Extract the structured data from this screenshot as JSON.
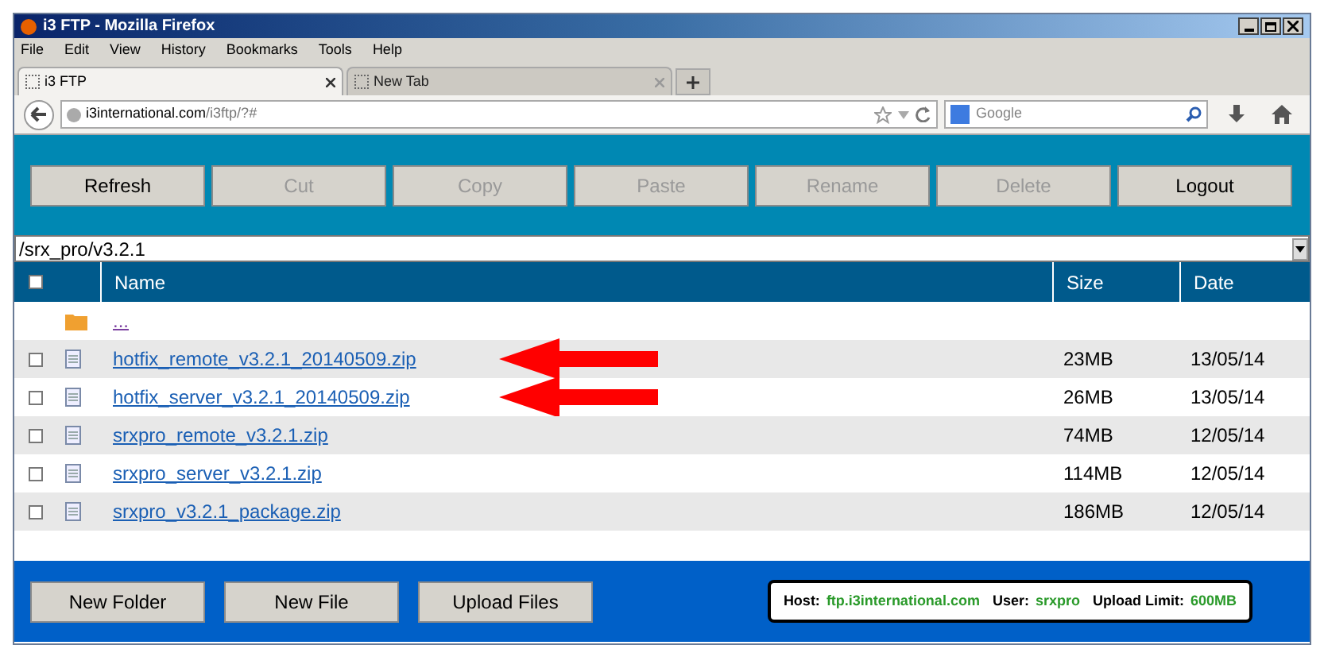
{
  "window": {
    "title": "i3 FTP - Mozilla Firefox"
  },
  "menu": [
    "File",
    "Edit",
    "View",
    "History",
    "Bookmarks",
    "Tools",
    "Help"
  ],
  "tabs": [
    {
      "label": "i3 FTP",
      "selected": true
    },
    {
      "label": "New Tab",
      "selected": false
    }
  ],
  "address": {
    "host": "i3international.com",
    "path": "/i3ftp/?#"
  },
  "search": {
    "placeholder": "Google"
  },
  "toolbar": [
    {
      "label": "Refresh",
      "disabled": false
    },
    {
      "label": "Cut",
      "disabled": true
    },
    {
      "label": "Copy",
      "disabled": true
    },
    {
      "label": "Paste",
      "disabled": true
    },
    {
      "label": "Rename",
      "disabled": true
    },
    {
      "label": "Delete",
      "disabled": true
    },
    {
      "label": "Logout",
      "disabled": false
    }
  ],
  "path": "/srx_pro/v3.2.1",
  "table": {
    "columns": [
      "Name",
      "Size",
      "Date"
    ],
    "select_all": false,
    "rows": [
      {
        "kind": "folder",
        "name": "..."
      },
      {
        "kind": "file",
        "name": "hotfix_remote_v3.2.1_20140509.zip",
        "size": "23MB",
        "date": "13/05/14",
        "checked": false,
        "annotated": true
      },
      {
        "kind": "file",
        "name": "hotfix_server_v3.2.1_20140509.zip",
        "size": "26MB",
        "date": "13/05/14",
        "checked": false,
        "annotated": true
      },
      {
        "kind": "file",
        "name": "srxpro_remote_v3.2.1.zip",
        "size": "74MB",
        "date": "12/05/14",
        "checked": false,
        "annotated": false
      },
      {
        "kind": "file",
        "name": "srxpro_server_v3.2.1.zip",
        "size": "114MB",
        "date": "12/05/14",
        "checked": false,
        "annotated": false
      },
      {
        "kind": "file",
        "name": "srxpro_v3.2.1_package.zip",
        "size": "186MB",
        "date": "12/05/14",
        "checked": false,
        "annotated": false
      }
    ]
  },
  "footer_buttons": [
    "New Folder",
    "New File",
    "Upload Files"
  ],
  "info": [
    {
      "label": "Host:",
      "value": "ftp.i3international.com"
    },
    {
      "label": "User:",
      "value": "srxpro"
    },
    {
      "label": "Upload Limit:",
      "value": "600MB"
    }
  ]
}
